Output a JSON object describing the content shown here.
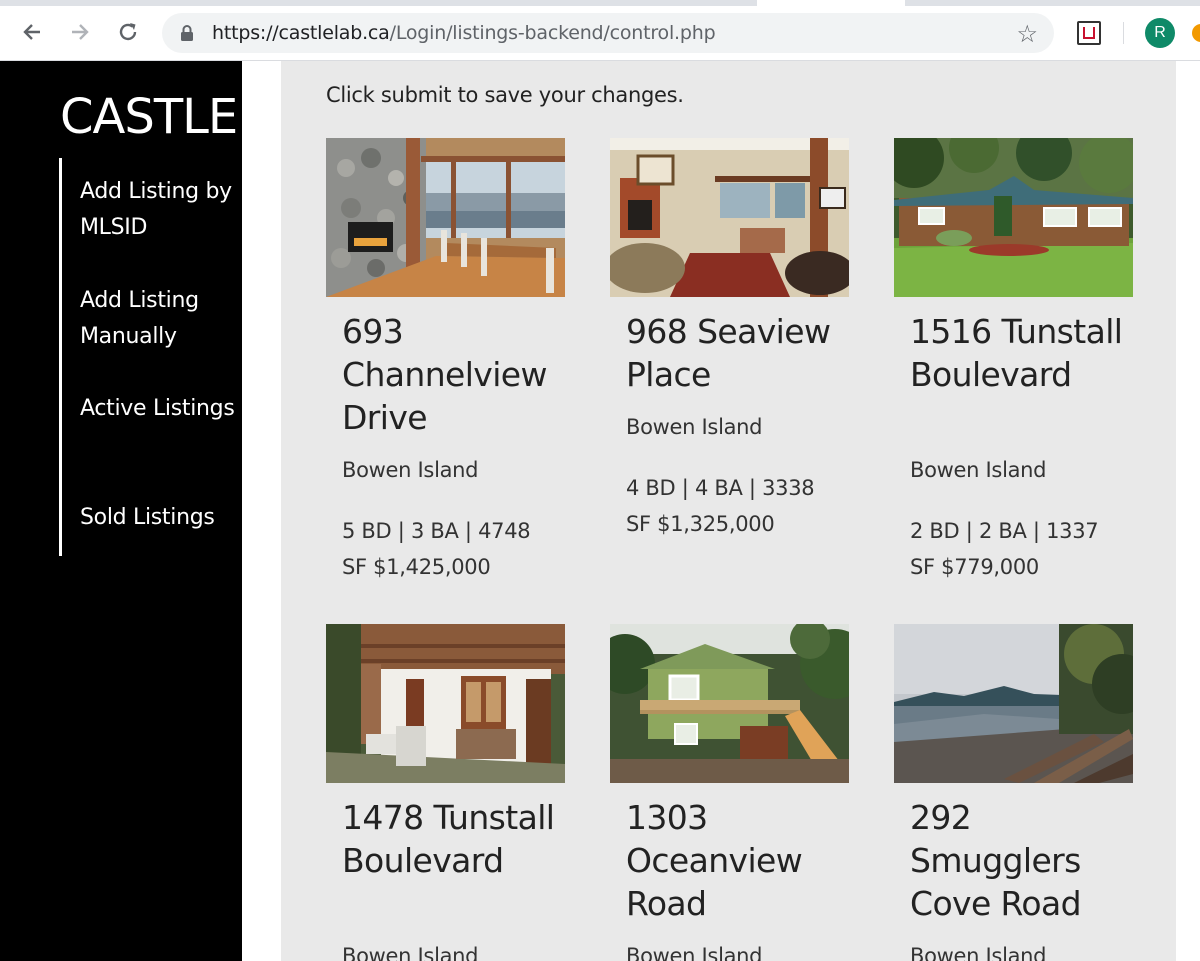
{
  "browser": {
    "url_host": "https://castlelab.ca",
    "url_path": "/Login/listings-backend/control.php",
    "avatar_initial": "R",
    "accent": "#0f8a68"
  },
  "sidebar": {
    "brand": "CASTLE",
    "items": [
      {
        "label": "Add Listing by MLSID"
      },
      {
        "label": "Add Listing Manually"
      },
      {
        "label": "Active Listings"
      },
      {
        "label": "Sold Listings"
      }
    ]
  },
  "main": {
    "instruction": "Click submit to save your changes.",
    "listings": [
      {
        "address": "693 Channelview Drive",
        "city": "Bowen Island",
        "stats": "5 BD | 3 BA | 4748 SF $1,425,000",
        "photo": "interior-dining-stone-fireplace"
      },
      {
        "address": "968 Seaview Place",
        "city": "Bowen Island",
        "stats": "4 BD | 4 BA | 3338 SF $1,325,000",
        "photo": "interior-living-room"
      },
      {
        "address": "1516 Tunstall Boulevard",
        "city": "Bowen Island",
        "stats": "2 BD | 2 BA | 1337 SF $779,000",
        "photo": "cabin-exterior-lawn"
      },
      {
        "address": "1478 Tunstall Boulevard",
        "city": "Bowen Island",
        "stats": "",
        "photo": "patio-white-house"
      },
      {
        "address": "1303 Oceanview Road",
        "city": "Bowen Island",
        "stats": "",
        "photo": "green-house-exterior"
      },
      {
        "address": "292 Smugglers Cove Road",
        "city": "Bowen Island",
        "stats": "",
        "photo": "beach-shoreline"
      }
    ]
  }
}
